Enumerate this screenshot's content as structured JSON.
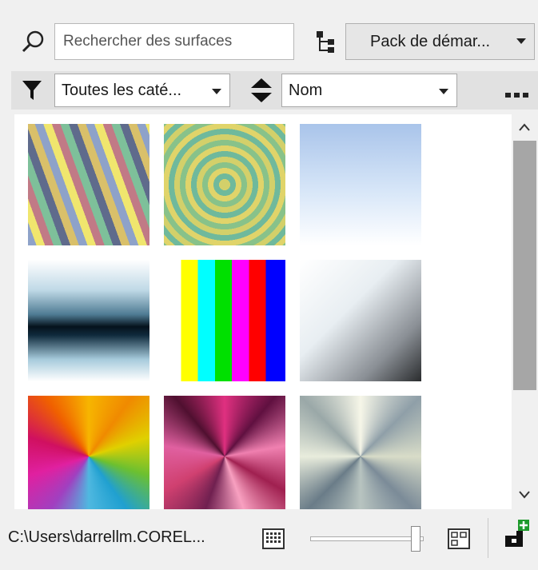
{
  "search": {
    "placeholder": "Rechercher des surfaces"
  },
  "pack": {
    "label": "Pack de démar..."
  },
  "filter": {
    "category": "Toutes les caté...",
    "sort": "Nom"
  },
  "status": {
    "path": "C:\\Users\\darrellm.COREL..."
  },
  "icons": [
    "search-icon",
    "hierarchy-icon",
    "filter-icon",
    "sort-icon",
    "more-icon",
    "small-thumbnails-icon",
    "large-thumbnails-icon",
    "add-library-icon"
  ],
  "zoom_slider": {
    "level": 0.93
  },
  "swatches": [
    "diagonal-stripes",
    "concentric-rings",
    "sky-gradient",
    "dark-band-gradient",
    "color-bars",
    "silver-diagonal",
    "rainbow-conical",
    "pink-conical",
    "metallic-conical"
  ]
}
